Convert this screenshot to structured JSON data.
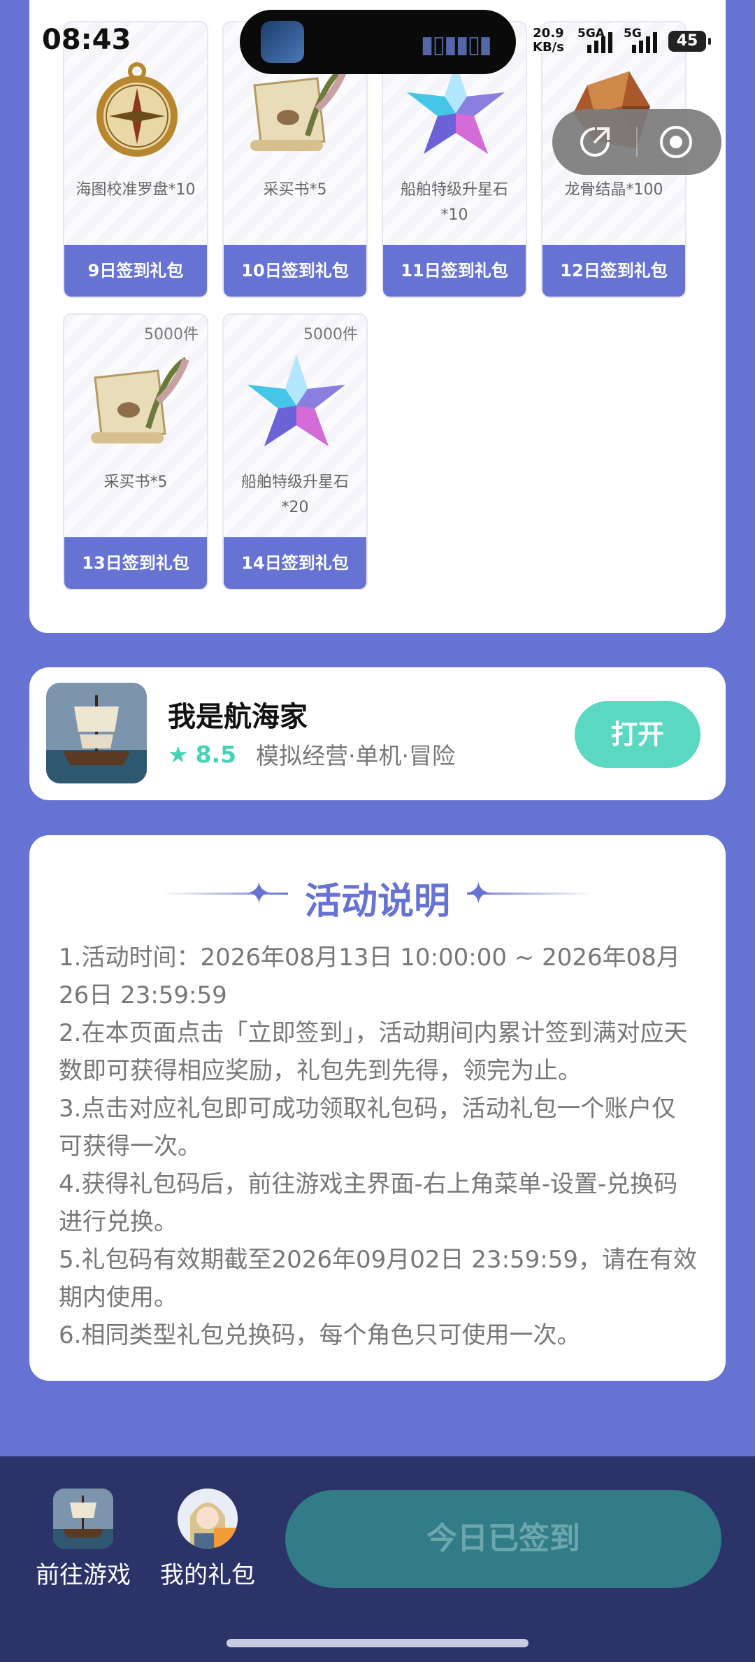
{
  "status_bar": {
    "time": "08:43",
    "net_speed": "20.9",
    "net_unit": "KB/s",
    "sim1": "5GA",
    "sim2": "5G",
    "battery": "45"
  },
  "gift_rows": [
    [
      {
        "stock": "",
        "name": "海图校准罗盘*10",
        "button": "9日签到礼包",
        "icon": "compass-icon"
      },
      {
        "stock": "",
        "name": "采买书*5",
        "button": "10日签到礼包",
        "icon": "scroll-quill-icon"
      },
      {
        "stock": "",
        "name": "船舶特级升星石*10",
        "button": "11日签到礼包",
        "icon": "crystal-star-icon"
      },
      {
        "stock": "",
        "name": "龙骨结晶*100",
        "button": "12日签到礼包",
        "icon": "amber-crystal-icon"
      }
    ],
    [
      {
        "stock": "5000件",
        "name": "采买书*5",
        "button": "13日签到礼包",
        "icon": "scroll-quill-icon"
      },
      {
        "stock": "5000件",
        "name": "船舶特级升星石*20",
        "button": "14日签到礼包",
        "icon": "crystal-star-icon"
      }
    ]
  ],
  "game": {
    "name": "我是航海家",
    "rating": "8.5",
    "tags": "模拟经营·单机·冒险",
    "open_label": "打开"
  },
  "activity": {
    "title": "活动说明",
    "rules": [
      "1.活动时间：2026年08月13日 10:00:00 ~ 2026年08月26日 23:59:59",
      "2.在本页面点击「立即签到」，活动期间内累计签到满对应天数即可获得相应奖励，礼包先到先得，领完为止。",
      "3.点击对应礼包即可成功领取礼包码，活动礼包一个账户仅可获得一次。",
      "4.获得礼包码后，前往游戏主界面-右上角菜单-设置-兑换码进行兑换。",
      "5.礼包码有效期截至2026年09月02日 23:59:59，请在有效期内使用。",
      "6.相同类型礼包兑换码，每个角色只可使用一次。"
    ]
  },
  "bottom_bar": {
    "goto_game": "前往游戏",
    "my_gifts": "我的礼包",
    "signed_label": "今日已签到"
  },
  "colors": {
    "accent": "#6673d2",
    "open_button": "#5ad8c2",
    "bottom_bar": "#2b3369",
    "signed_button": "#317c86"
  }
}
